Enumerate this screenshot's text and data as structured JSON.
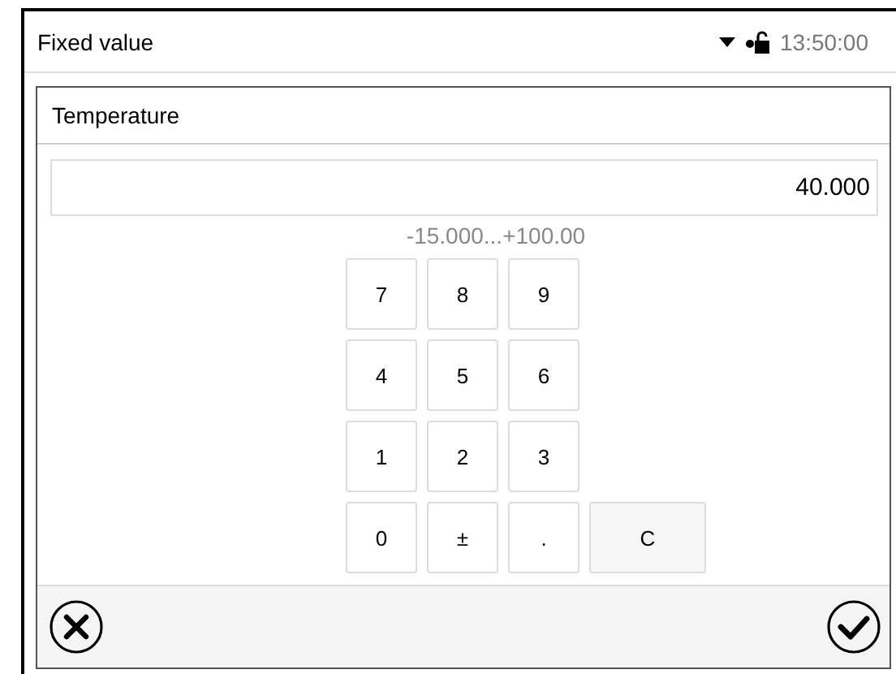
{
  "header": {
    "title": "Fixed value",
    "time": "13:50:00"
  },
  "dialog": {
    "title": "Temperature",
    "value": "40.000",
    "range": "-15.000...+100.00",
    "keys": [
      {
        "label": "7",
        "kind": "digit"
      },
      {
        "label": "8",
        "kind": "digit"
      },
      {
        "label": "9",
        "kind": "digit"
      },
      {
        "label": "4",
        "kind": "digit"
      },
      {
        "label": "5",
        "kind": "digit"
      },
      {
        "label": "6",
        "kind": "digit"
      },
      {
        "label": "1",
        "kind": "digit"
      },
      {
        "label": "2",
        "kind": "digit"
      },
      {
        "label": "3",
        "kind": "digit"
      },
      {
        "label": "0",
        "kind": "digit"
      },
      {
        "label": "±",
        "kind": "digit"
      },
      {
        "label": ".",
        "kind": "digit"
      },
      {
        "label": "C",
        "kind": "wide"
      }
    ]
  }
}
